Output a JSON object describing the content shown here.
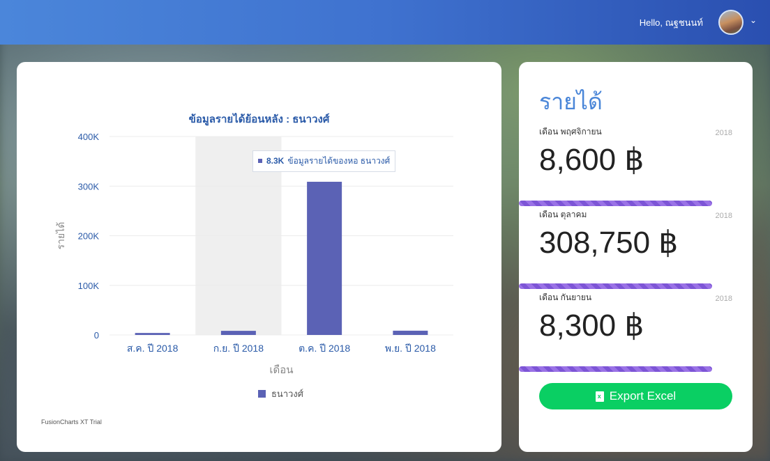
{
  "header": {
    "greeting": "Hello, ณฐชนนท์",
    "avatar_icon": "user-avatar",
    "menu_icon": "chevron-down-icon"
  },
  "chart_card": {
    "trial_text": "FusionCharts XT Trial",
    "tooltip": {
      "value": "8.3K",
      "label": "ข้อมูลรายได้ของหอ ธนาวงศ์"
    },
    "legend_label": "ธนาวงศ์"
  },
  "chart_data": {
    "type": "bar",
    "title": "ข้อมูลรายได้ย้อนหลัง : ธนาวงศ์",
    "xlabel": "เดือน",
    "ylabel": "รายได้",
    "categories": [
      "ส.ค. ปี 2018",
      "ก.ย. ปี 2018",
      "ต.ค. ปี 2018",
      "พ.ย. ปี 2018"
    ],
    "series": [
      {
        "name": "ธนาวงศ์",
        "values": [
          4000,
          8300,
          308750,
          8600
        ],
        "color": "#5b62b5"
      }
    ],
    "ylim": [
      0,
      400000
    ],
    "yticks": [
      0,
      100000,
      200000,
      300000,
      400000
    ],
    "ytick_labels": [
      "0",
      "100K",
      "200K",
      "300K",
      "400K"
    ],
    "highlighted_category": "ก.ย. ปี 2018",
    "legend_position": "bottom",
    "grid": true
  },
  "revenue": {
    "title": "รายได้",
    "items": [
      {
        "month": "เดือน พฤศจิกายน",
        "year": "2018",
        "amount": "8,600 ฿"
      },
      {
        "month": "เดือน ตุลาคม",
        "year": "2018",
        "amount": "308,750 ฿"
      },
      {
        "month": "เดือน กันยายน",
        "year": "2018",
        "amount": "8,300 ฿"
      }
    ],
    "export_label": "Export Excel",
    "export_icon": "file-excel-icon",
    "accent_color": "#4a86d8",
    "button_color": "#0acf63"
  }
}
